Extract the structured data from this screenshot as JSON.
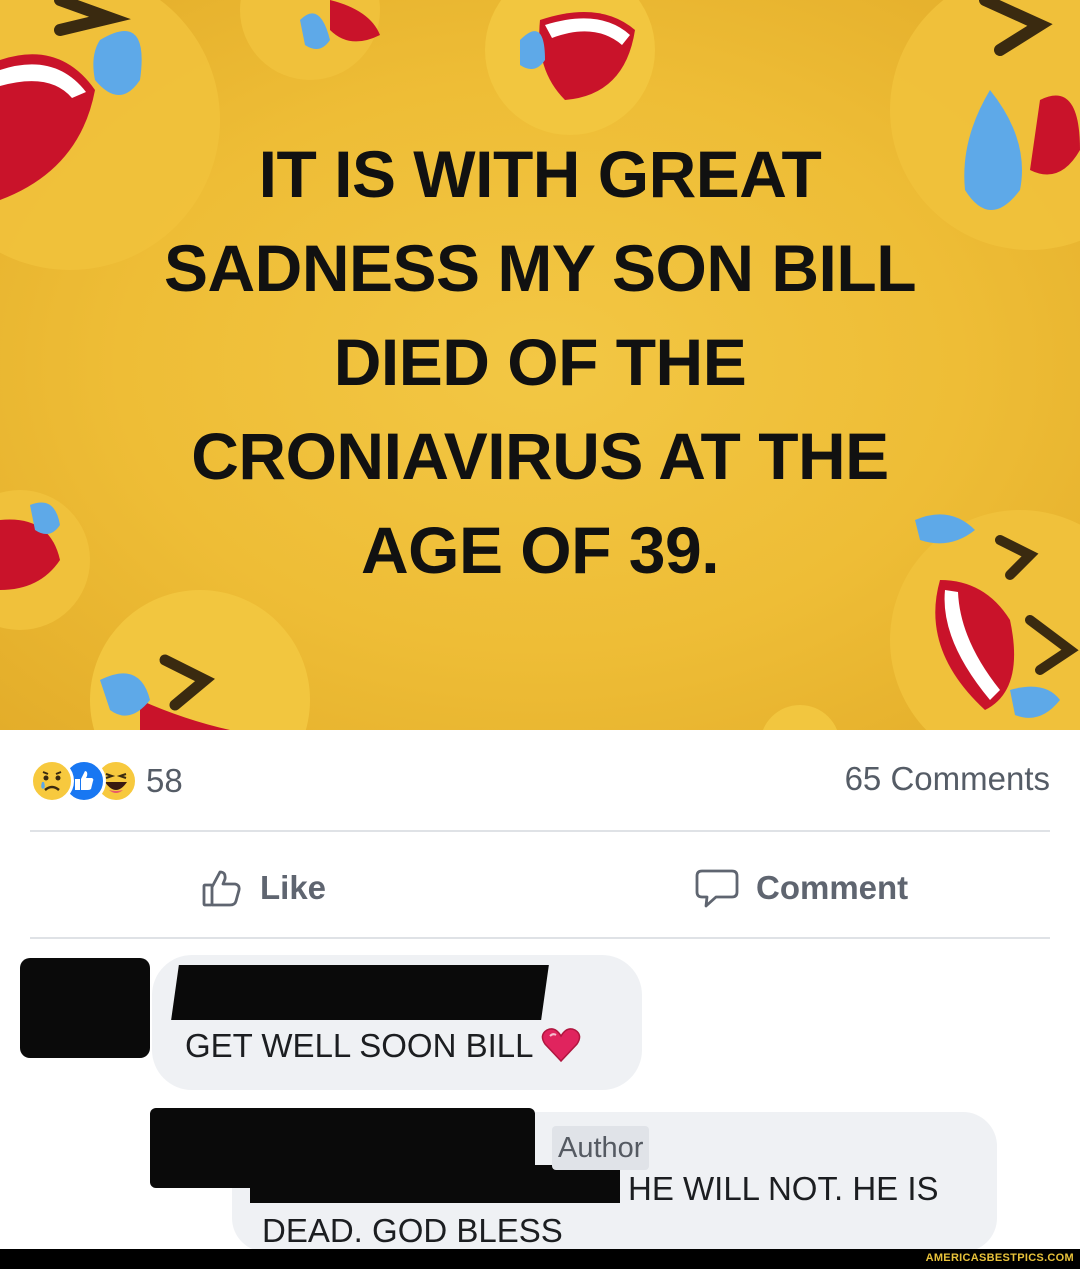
{
  "post": {
    "image_text_lines": [
      "IT IS WITH GREAT",
      "SADNESS MY SON BILL",
      "DIED OF THE",
      "CRONIAVIRUS AT THE",
      "AGE OF 39."
    ],
    "background_color": "#eebd36"
  },
  "reactions": {
    "types": [
      "sad-icon",
      "like-icon",
      "haha-icon"
    ],
    "count": "58",
    "comments_label": "65 Comments"
  },
  "actions": {
    "like_label": "Like",
    "comment_label": "Comment"
  },
  "comments": [
    {
      "text": "GET WELL SOON BILL",
      "emoji": "heart-icon"
    },
    {
      "badge": "Author",
      "text_line1": "HE WILL NOT. HE IS",
      "text_line2": "DEAD. GOD BLESS"
    }
  ],
  "watermark": "AMERICASBESTPICS.COM",
  "colors": {
    "accent_like": "#1877f2",
    "text_muted": "#5f6570",
    "heart": "#e0245e"
  }
}
